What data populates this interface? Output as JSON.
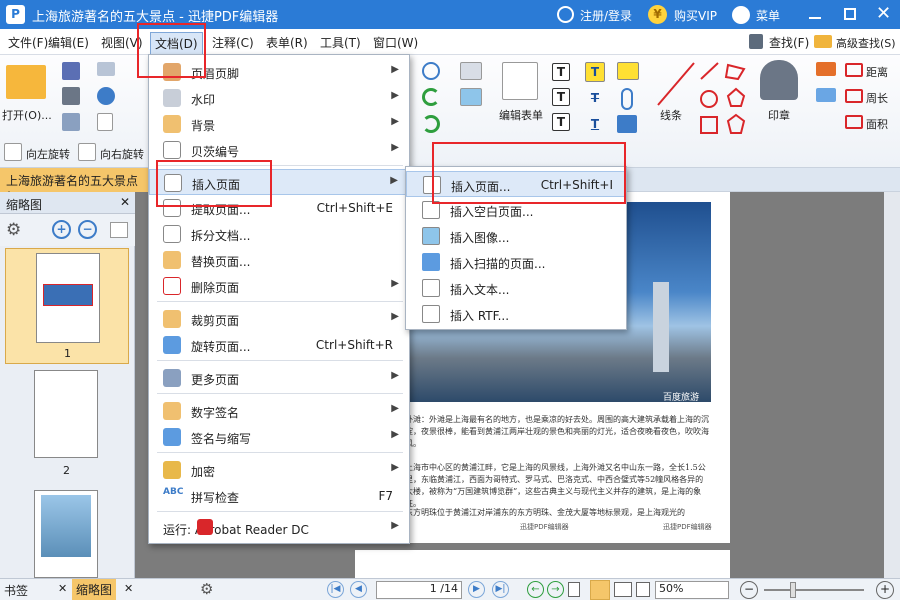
{
  "window": {
    "title": "上海旅游著名的五大景点 - 迅捷PDF编辑器",
    "register": "注册/登录",
    "vip": "购买VIP",
    "menu": "菜单"
  },
  "menubar": [
    "文件(F)",
    "编辑(E)",
    "视图(V)",
    "文档(D)",
    "注释(C)",
    "表单(R)",
    "工具(T)",
    "窗口(W)"
  ],
  "ribbon": {
    "open": "打开(O)...",
    "rotate_left": "向左旋转",
    "rotate_right": "向右旋转",
    "edit_form": "编辑表单",
    "line": "线条",
    "stamp": "印章",
    "search": "查找(F)",
    "adv_search": "高级查找(S)",
    "distance": "距离",
    "perimeter": "周长",
    "area": "面积"
  },
  "doc_tab": "上海旅游著名的五大景点 *",
  "left_panel": {
    "title": "缩略图",
    "thumbs": [
      "1",
      "2"
    ],
    "tabs": [
      "书签",
      "缩略图"
    ]
  },
  "doc_menu": [
    {
      "label": "页眉页脚",
      "shortcut": "",
      "submenu": true
    },
    {
      "label": "水印",
      "shortcut": "",
      "submenu": true
    },
    {
      "label": "背景",
      "shortcut": "",
      "submenu": true
    },
    {
      "label": "贝茨编号",
      "shortcut": "",
      "submenu": true
    },
    {
      "label": "插入页面",
      "shortcut": "",
      "submenu": true
    },
    {
      "label": "提取页面...",
      "shortcut": "Ctrl+Shift+E",
      "submenu": false
    },
    {
      "label": "拆分文档...",
      "shortcut": "",
      "submenu": false
    },
    {
      "label": "替换页面...",
      "shortcut": "",
      "submenu": false
    },
    {
      "label": "删除页面",
      "shortcut": "",
      "submenu": true
    },
    {
      "label": "裁剪页面",
      "shortcut": "",
      "submenu": true
    },
    {
      "label": "旋转页面...",
      "shortcut": "Ctrl+Shift+R",
      "submenu": false
    },
    {
      "label": "更多页面",
      "shortcut": "",
      "submenu": true
    },
    {
      "label": "数字签名",
      "shortcut": "",
      "submenu": true
    },
    {
      "label": "签名与缩写",
      "shortcut": "",
      "submenu": true
    },
    {
      "label": "加密",
      "shortcut": "",
      "submenu": true
    },
    {
      "label": "拼写检查",
      "shortcut": "F7",
      "submenu": false
    },
    {
      "label": "运行:  Acrobat Reader DC",
      "shortcut": "",
      "submenu": true
    }
  ],
  "insert_submenu": [
    {
      "label": "插入页面...",
      "shortcut": "Ctrl+Shift+I"
    },
    {
      "label": "插入空白页面...",
      "shortcut": ""
    },
    {
      "label": "插入图像...",
      "shortcut": ""
    },
    {
      "label": "插入扫描的页面...",
      "shortcut": ""
    },
    {
      "label": "插入文本...",
      "shortcut": ""
    },
    {
      "label": "插入 RTF...",
      "shortcut": ""
    }
  ],
  "document_text": {
    "p1": "外滩：外滩是上海最有名的地方，也是乘凉的好去处。周围的高大建筑承载着上海的沉淀，夜景很棒，能看到黄浦江两岸壮观的景色和亮丽的灯光，适合夜晚看夜色，吹吹海风。",
    "p2": "上海市中心区的黄浦江畔，它是上海的风景线，上海外滩又名中山东一路，全长1.5公里，东临黄浦江，西面为哥特式、罗马式、巴洛克式、中西合璧式等52幢风格各异的大楼，被称为“万国建筑博览群”，这些古典主义与现代主义并存的建筑，是上海的象征。",
    "p3": "东方明珠位于黄浦江对岸浦东的东方明珠、金茂大厦等地标景观，是上海观光的",
    "footer": "迅捷PDF编辑器",
    "watermark": "百度旅游"
  },
  "status": {
    "page": "1 /14",
    "zoom": "50%"
  }
}
